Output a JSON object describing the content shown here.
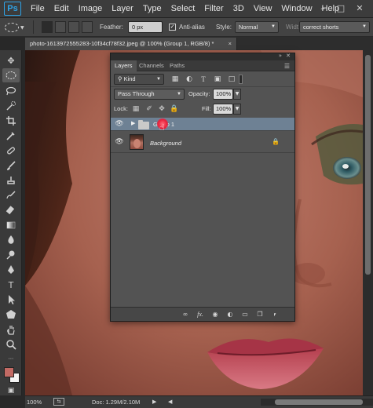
{
  "app": {
    "logo": "Ps",
    "menu": [
      "File",
      "Edit",
      "Image",
      "Layer",
      "Type",
      "Select",
      "Filter",
      "3D",
      "View",
      "Window",
      "Help"
    ],
    "window_controls": [
      "minimize-icon",
      "maximize-icon",
      "close-icon"
    ]
  },
  "options": {
    "feather_label": "Feather:",
    "feather_value": "0 px",
    "antialias_label": "Anti-alias",
    "antialias_checked": true,
    "style_label": "Style:",
    "style_value": "Normal",
    "width_label": "Widt",
    "workspace_value": "correct shorts"
  },
  "document": {
    "tab_title": "photo-1613972555283-10f34cf78f32.jpeg @ 100% (Group 1, RGB/8) *",
    "close": "×"
  },
  "layers_panel": {
    "tabs": [
      "Layers",
      "Channels",
      "Paths"
    ],
    "active_tab": "Layers",
    "filter_kind": "Kind",
    "blend_mode": "Pass Through",
    "opacity_label": "Opacity:",
    "opacity_value": "100%",
    "lock_label": "Lock:",
    "fill_label": "Fill:",
    "fill_value": "100%",
    "layers": [
      {
        "name": "Group 1",
        "type": "group",
        "selected": true,
        "visible": true
      },
      {
        "name": "Background",
        "type": "image",
        "selected": false,
        "visible": true,
        "locked": true
      }
    ],
    "bottom_icons": [
      "link-icon",
      "fx-icon",
      "mask-icon",
      "adjustment-icon",
      "folder-icon",
      "new-layer-icon",
      "trash-icon"
    ],
    "bottom_fx": "fx."
  },
  "status": {
    "zoom": "100%",
    "doc_info": "Doc: 1.29M/2.10M"
  },
  "colors": {
    "foreground": "#c26a64",
    "background": "#f5f5f5",
    "selection_highlight": "#6e8194",
    "brand": "#2fa3e6"
  }
}
